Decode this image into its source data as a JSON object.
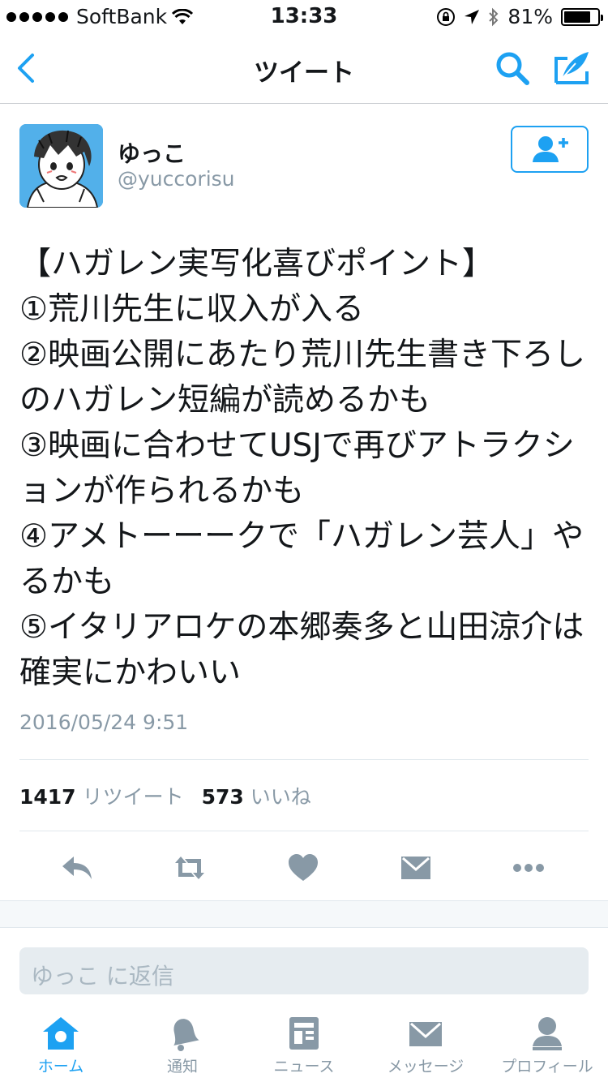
{
  "status_bar": {
    "carrier": "SoftBank",
    "time": "13:33",
    "battery": "81%",
    "battery_level": 0.81
  },
  "nav": {
    "title": "ツイート",
    "back_icon": "chevron-left-icon",
    "search_icon": "search-icon",
    "compose_icon": "compose-feather-icon"
  },
  "tweet": {
    "display_name": "ゆっこ",
    "handle": "@yuccorisu",
    "text": "【ハガレン実写化喜びポイント】\n①荒川先生に収入が入る\n②映画公開にあたり荒川先生書き下ろしのハガレン短編が読めるかも\n③映画に合わせてUSJで再びアトラクションが作られるかも\n④アメトーーークで「ハガレン芸人」やるかも\n⑤イタリアロケの本郷奏多と山田涼介は確実にかわいい",
    "timestamp": "2016/05/24 9:51",
    "retweet_count": "1417",
    "retweet_label": "リツイート",
    "like_count": "573",
    "like_label": "いいね"
  },
  "reply": {
    "placeholder": "ゆっこ に返信"
  },
  "tab_bar": {
    "items": [
      {
        "label": "ホーム",
        "icon": "home-icon",
        "active": true
      },
      {
        "label": "通知",
        "icon": "bell-icon",
        "active": false
      },
      {
        "label": "ニュース",
        "icon": "news-icon",
        "active": false
      },
      {
        "label": "メッセージ",
        "icon": "envelope-icon",
        "active": false
      },
      {
        "label": "プロフィール",
        "icon": "profile-icon",
        "active": false
      }
    ]
  },
  "colors": {
    "accent": "#1da1f2",
    "icon_gray": "#8899a6",
    "text": "#14171a"
  }
}
